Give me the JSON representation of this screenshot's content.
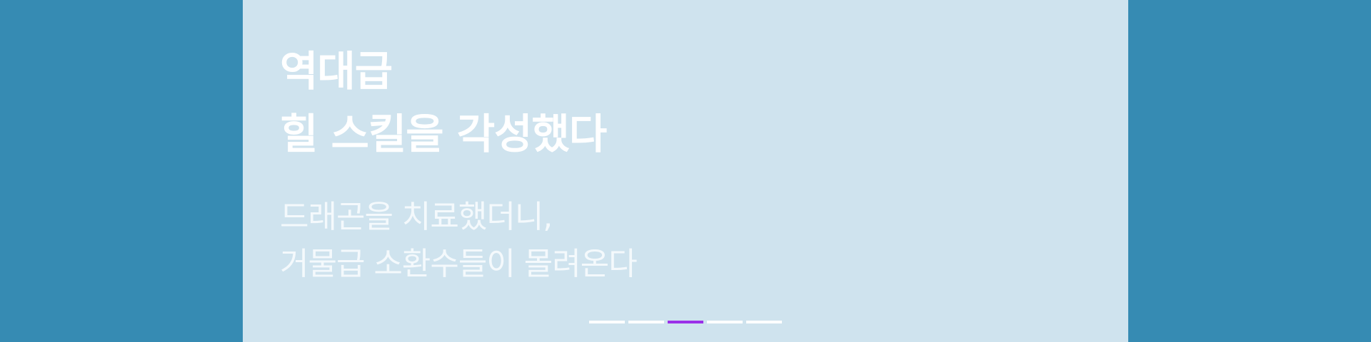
{
  "banner": {
    "headline": [
      "역대급",
      "힐 스킬을 각성했다"
    ],
    "subtext": [
      "드래곤을 치료했더니,",
      "거물급 소환수들이 몰려온다"
    ]
  },
  "pager": {
    "count": 5,
    "active_index": 2
  },
  "colors": {
    "outer_background": "#368bb3",
    "banner_background": "#cfe3ee",
    "headline_text": "#ffffff",
    "pager_inactive": "#ffffff",
    "pager_active": "#9b30e8"
  }
}
